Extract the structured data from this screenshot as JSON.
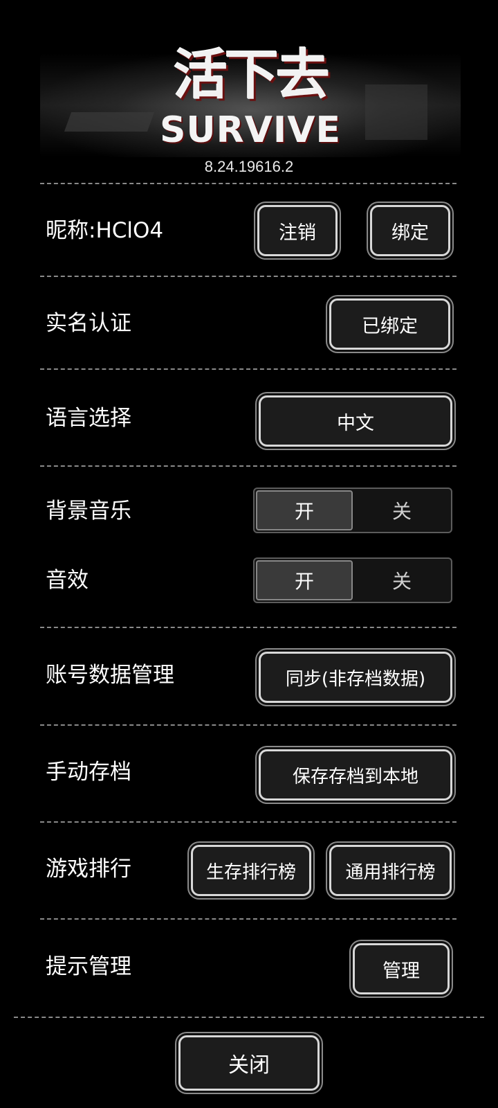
{
  "header": {
    "logo_cn": "活下去",
    "logo_en": "SURVIVE",
    "version": "8.24.19616.2"
  },
  "account": {
    "nickname_label": "昵称:HClO4",
    "logout_label": "注销",
    "bind_label": "绑定"
  },
  "realname": {
    "label": "实名认证",
    "button_label": "已绑定"
  },
  "language": {
    "label": "语言选择",
    "button_label": "中文"
  },
  "bgm": {
    "label": "背景音乐",
    "on_label": "开",
    "off_label": "关",
    "selected": "开"
  },
  "sfx": {
    "label": "音效",
    "on_label": "开",
    "off_label": "关",
    "selected": "开"
  },
  "account_data": {
    "label": "账号数据管理",
    "button_label": "同步(非存档数据)"
  },
  "manual_save": {
    "label": "手动存档",
    "button_label": "保存存档到本地"
  },
  "ranking": {
    "label": "游戏排行",
    "survival_label": "生存排行榜",
    "general_label": "通用排行榜"
  },
  "tips": {
    "label": "提示管理",
    "button_label": "管理"
  },
  "close_label": "关闭",
  "colors": {
    "background": "#000000",
    "button_fill": "#1c1c1c",
    "button_border": "#d8d8d8",
    "toggle_selected": "#3a3a3a"
  }
}
